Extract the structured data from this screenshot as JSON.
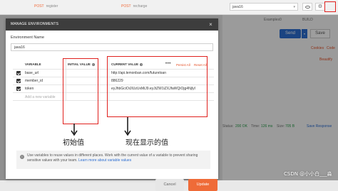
{
  "background": {
    "tabs": [
      {
        "method": "POST",
        "name": "register"
      },
      {
        "method": "POST",
        "name": "recharge"
      }
    ],
    "environment_selected": "java16",
    "examples_label": "Examples",
    "examples_count": "0",
    "build_label": "BUILD",
    "send_label": "Send",
    "save_label": "Save",
    "cookies_label": "Cookies",
    "code_label": "Code",
    "beautify_label": "Beautify",
    "status_label": "Status:",
    "status_value": "200 OK",
    "time_label": "Time:",
    "time_value": "126 ms",
    "size_label": "Size:",
    "size_value": "705 B",
    "save_response_label": "Save Response"
  },
  "modal": {
    "title": "MANAGE ENVIRONMENTS",
    "close_icon": "×",
    "env_name_label": "Environment Name",
    "env_name_value": "java16",
    "columns": {
      "variable": "VARIABLE",
      "initial_value": "INITIAL VALUE",
      "current_value": "CURRENT VALUE"
    },
    "more_actions": "•••",
    "persist_all": "Persist All",
    "reset_all": "Reset All",
    "variables": [
      {
        "checked": true,
        "name": "base_url",
        "initial": "",
        "current": "http://api.lemonban.com/futureloan"
      },
      {
        "checked": true,
        "name": "member_id",
        "initial": "",
        "current": "886229"
      },
      {
        "checked": true,
        "name": "token",
        "initial": "",
        "current": "eyJhbGciOiJIUzUxMiJ9.eyJtZW1iZXJfaWQiOjg4NjIyOSwiZXhw"
      }
    ],
    "add_variable_placeholder": "Add a new variable",
    "info_text": "Use variables to reuse values in different places. Work with the current value of a variable to prevent sharing sensitive values with your team.",
    "info_link": "Learn more about variable values",
    "cancel_label": "Cancel",
    "update_label": "Update"
  },
  "annotations": {
    "initial_label": "初始值",
    "current_label": "现在显示的值"
  },
  "watermark": "CSDN @小小白___淼",
  "colors": {
    "accent_orange": "#ef6b38",
    "send_blue": "#2d6ed1",
    "annotation_red": "#e0201d"
  }
}
